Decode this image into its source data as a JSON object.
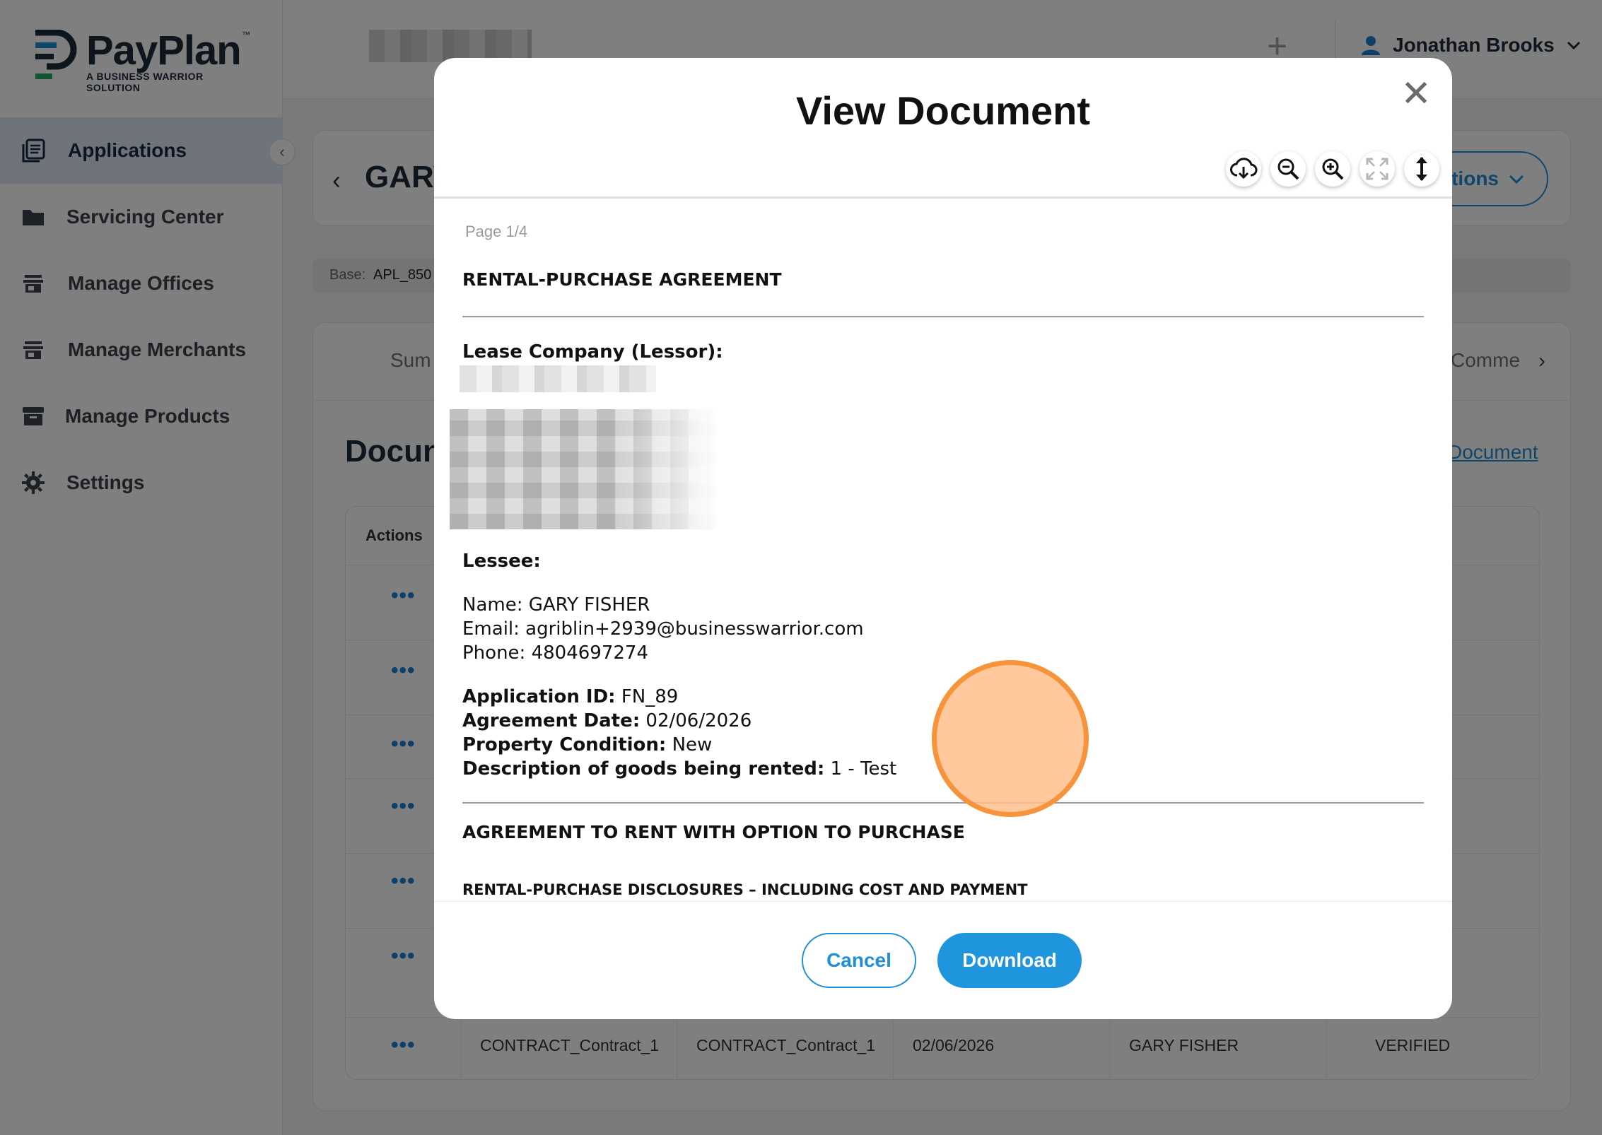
{
  "app": {
    "logo_text": "PayPlan",
    "logo_tm": "™",
    "logo_subtitle": "A BUSINESS WARRIOR SOLUTION",
    "brand_colors": {
      "navy": "#1c2a3a",
      "blue": "#1f8fd8",
      "green": "#2aa864"
    }
  },
  "sidebar": {
    "items": [
      {
        "label": "Applications",
        "icon": "applications-icon",
        "active": true
      },
      {
        "label": "Servicing Center",
        "icon": "folder-icon",
        "active": false
      },
      {
        "label": "Manage Offices",
        "icon": "store-icon",
        "active": false
      },
      {
        "label": "Manage Merchants",
        "icon": "store-icon",
        "active": false
      },
      {
        "label": "Manage Products",
        "icon": "archive-icon",
        "active": false
      },
      {
        "label": "Settings",
        "icon": "gear-icon",
        "active": false
      }
    ],
    "collapse_glyph": "‹"
  },
  "topbar": {
    "plus_glyph": "+",
    "user_name": "Jonathan Brooks"
  },
  "page": {
    "back_glyph": "‹",
    "applicant_name_partial": "GARY",
    "actions_label_partial": "tions",
    "base_label": "Base:",
    "base_value_partial": "APL_850",
    "tab_first_partial": "Sum",
    "tab_last_partial": "Comme",
    "tab_next_glyph": "›",
    "section_title_partial": "Docun",
    "upload_link_partial": "Document",
    "table": {
      "actions_header": "Actions",
      "dots": "•••",
      "last_row": [
        "CONTRACT_Contract_1",
        "CONTRACT_Contract_1",
        "02/06/2026",
        "GARY FISHER",
        "VERIFIED"
      ]
    }
  },
  "modal": {
    "title": "View Document",
    "close_glyph": "✕",
    "toolbar": [
      "cloud-download-icon",
      "zoom-out-icon",
      "zoom-in-icon",
      "fullscreen-icon",
      "fit-height-icon"
    ],
    "page_indicator": "Page 1/4",
    "document": {
      "title": "RENTAL-PURCHASE AGREEMENT",
      "lessor_label": "Lease Company (Lessor):",
      "lessee_label": "Lessee:",
      "name_line": "Name:  GARY FISHER",
      "email_line": "Email: agriblin+2939@businesswarrior.com",
      "phone_line": "Phone: 4804697274",
      "application_id_label": "Application ID:",
      "application_id_value": "FN_89",
      "agreement_date_label": "Agreement Date:",
      "agreement_date_value": "02/06/2026",
      "property_condition_label": "Property Condition:",
      "property_condition_value": "New",
      "goods_label": "Description of goods being rented:",
      "goods_value": "1 - Test",
      "section_title": "AGREEMENT TO RENT WITH OPTION TO PURCHASE",
      "section_subtitle": "RENTAL-PURCHASE DISCLOSURES – INCLUDING COST AND PAYMENT"
    },
    "cancel_label": "Cancel",
    "download_label": "Download"
  }
}
